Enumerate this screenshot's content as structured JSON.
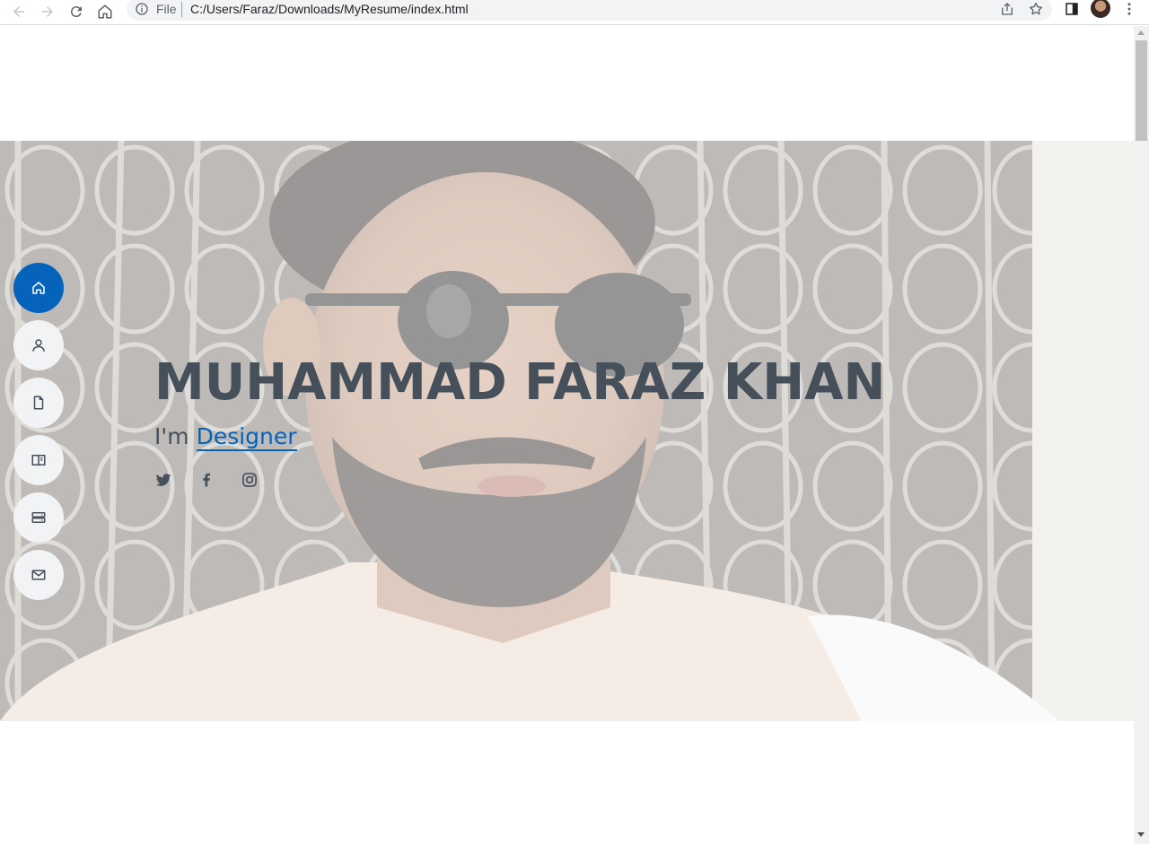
{
  "browser": {
    "scheme_label": "File",
    "url": "C:/Users/Faraz/Downloads/MyResume/index.html",
    "icons": [
      "back-arrow-icon",
      "forward-arrow-icon",
      "reload-icon",
      "home-icon",
      "info-icon",
      "share-icon",
      "bookmark-star-icon",
      "side-panel-icon",
      "profile-avatar",
      "kebab-menu-icon"
    ]
  },
  "colors": {
    "accent": "#0563bb",
    "heading": "#45505b",
    "nav_bg": "#f2f3f5"
  },
  "hero": {
    "name": "MUHAMMAD FARAZ KHAN",
    "tagline_prefix": "I'm",
    "tagline_role": "Designer"
  },
  "social": [
    {
      "icon": "twitter-icon"
    },
    {
      "icon": "facebook-icon"
    },
    {
      "icon": "instagram-icon"
    }
  ],
  "sidenav": [
    {
      "icon": "home-icon",
      "active": true
    },
    {
      "icon": "person-icon",
      "active": false
    },
    {
      "icon": "file-icon",
      "active": false
    },
    {
      "icon": "book-icon",
      "active": false
    },
    {
      "icon": "server-icon",
      "active": false
    },
    {
      "icon": "envelope-icon",
      "active": false
    }
  ]
}
